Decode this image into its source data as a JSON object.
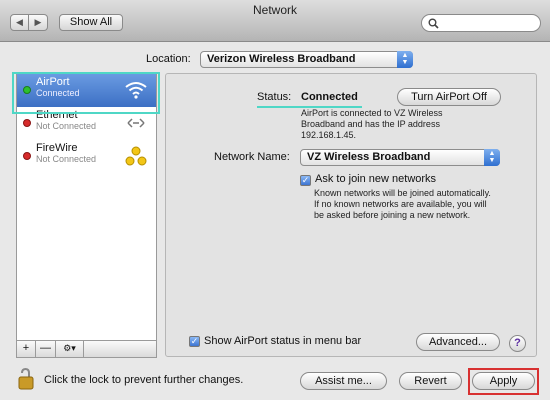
{
  "window": {
    "title": "Network"
  },
  "toolbar": {
    "back_glyph": "◀",
    "forward_glyph": "▶",
    "show_all_label": "Show All"
  },
  "location": {
    "label": "Location:",
    "value": "Verizon Wireless Broadband"
  },
  "services": [
    {
      "name": "AirPort",
      "status": "Connected",
      "dot_color": "#2ec02e",
      "icon": "wifi-icon",
      "selected": true
    },
    {
      "name": "Ethernet",
      "status": "Not Connected",
      "dot_color": "#d62b2b",
      "icon": "ethernet-icon",
      "selected": false
    },
    {
      "name": "FireWire",
      "status": "Not Connected",
      "dot_color": "#d62b2b",
      "icon": "firewire-icon",
      "selected": false
    }
  ],
  "sidebar_tools": {
    "add": "+",
    "remove": "—",
    "action": "⚙▾"
  },
  "detail": {
    "status_label": "Status:",
    "status_value": "Connected",
    "turn_off_label": "Turn AirPort Off",
    "status_description_line1": "AirPort is connected to VZ Wireless",
    "status_description_line2": "Broadband and has the IP address",
    "status_description_line3": "192.168.1.45.",
    "network_name_label": "Network Name:",
    "network_name_value": "VZ Wireless Broadband",
    "ask_to_join_label": "Ask to join new networks",
    "ask_to_join_checked": true,
    "ask_help_line1": "Known networks will be joined automatically.",
    "ask_help_line2": "If no known networks are available, you will",
    "ask_help_line3": "be asked before joining a new network.",
    "show_status_label": "Show AirPort status in menu bar",
    "show_status_checked": true,
    "advanced_label": "Advanced...",
    "help_glyph": "?"
  },
  "footer": {
    "lock_text": "Click the lock to prevent further changes.",
    "assist_label": "Assist me...",
    "revert_label": "Revert",
    "apply_label": "Apply"
  },
  "colors": {
    "selection": "#3c6fc4",
    "annotation_teal": "#4fd7c6",
    "annotation_red": "#d83131",
    "accent_blue": "#2f6fd0"
  }
}
